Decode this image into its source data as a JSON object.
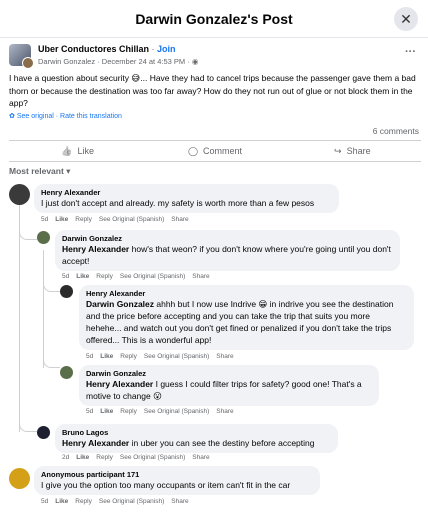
{
  "header": {
    "title": "Darwin Gonzalez's Post",
    "close_glyph": "✕"
  },
  "post": {
    "group_name": "Uber Conductores Chillan",
    "sep": " · ",
    "join_label": "Join",
    "meta": "Darwin Gonzalez · December 24 at 4:53 PM · ",
    "globe_glyph": "◉",
    "more_glyph": "···",
    "text": "I have a question about security 😅... Have they had to cancel trips because the passenger gave them a bad thorn or because the destination was too far away? How do they not run out of glue or not block them in the app?",
    "see_original": "See original · Rate this translation",
    "gear_glyph": "✿",
    "comment_count": "6 comments"
  },
  "actions": {
    "like": "Like",
    "comment": "Comment",
    "share": "Share",
    "like_icon": "👍",
    "comment_icon": "◯",
    "share_icon": "↪"
  },
  "sort": {
    "label": "Most relevant",
    "chevron": "▾"
  },
  "link_labels": {
    "like": "Like",
    "reply": "Reply",
    "see_original": "See Original (Spanish)",
    "share": "Share"
  },
  "comments": [
    {
      "author": "Henry Alexander",
      "mention": "",
      "text": "I just don't accept and already. my safety is worth more than a few pesos",
      "time": "5d"
    },
    {
      "author": "Darwin Gonzalez",
      "mention": "Henry Alexander",
      "text": " how's that weon? if you don't know where you're going until you don't accept!",
      "time": "5d"
    },
    {
      "author": "Henry Alexander",
      "mention": "Darwin Gonzalez",
      "text": " ahhh but I now use Indrive 😁 in indrive you see the destination and the price before accepting and you can take the trip that suits you more hehehe... and watch out you don't get fined or penalized if you don't take the trips offered... This is a wonderful app!",
      "time": "5d"
    },
    {
      "author": "Darwin Gonzalez",
      "mention": "Henry Alexander",
      "text": " I guess I could filter trips for safety? good one! That's a motive to change 😮",
      "time": "5d"
    },
    {
      "author": "Bruno Lagos",
      "mention": "Henry Alexander",
      "text": " in uber you can see the destiny before accepting",
      "time": "2d"
    },
    {
      "author": "Anonymous participant 171",
      "mention": "",
      "text": "I give you the option too many occupants or item can't fit in the car",
      "time": "5d"
    }
  ],
  "colors": {
    "accent": "#1877f2",
    "muted": "#65676b",
    "bubble": "#f0f2f5"
  }
}
